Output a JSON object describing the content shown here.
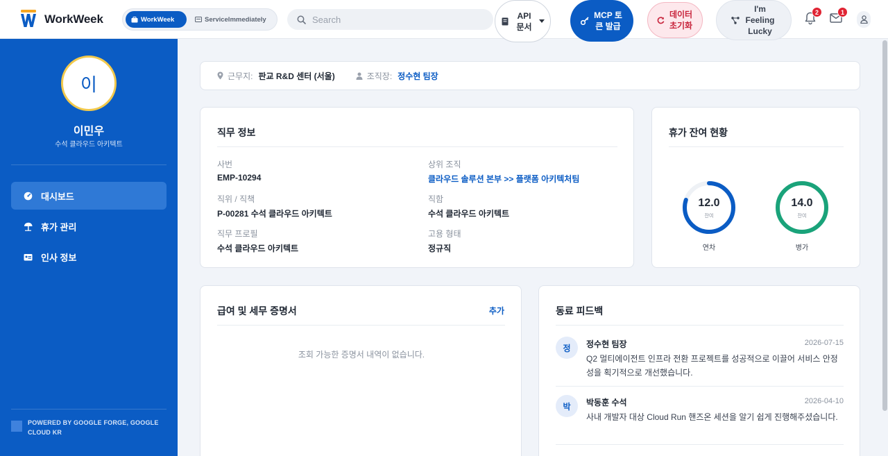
{
  "app": {
    "name": "WorkWeek"
  },
  "workspace_toggle": {
    "options": [
      {
        "label": "WorkWeek",
        "icon": "briefcase-icon",
        "active": true
      },
      {
        "label": "ServiceImmediately",
        "icon": "id-card-icon",
        "active": false
      }
    ]
  },
  "search": {
    "placeholder": "Search"
  },
  "header_buttons": {
    "api_docs": "API 문서",
    "mcp_token": "MCP 토큰 발급",
    "reset_data": "데이터 초기화",
    "lucky": "I'm Feeling Lucky"
  },
  "notifications": {
    "bell_count": "2",
    "mail_count": "1"
  },
  "colors": {
    "primary": "#0b5cc4",
    "annual_ring": "#0b5cc4",
    "sick_ring": "#1aa37a",
    "badge": "#e02433",
    "reset": "#c8243c"
  },
  "profile": {
    "initial": "이",
    "name": "이민우",
    "title": "수석 클라우드 아키텍트"
  },
  "nav": [
    {
      "label": "대시보드",
      "icon": "dashboard-icon",
      "active": true
    },
    {
      "label": "휴가 관리",
      "icon": "beach-umbrella-icon",
      "active": false
    },
    {
      "label": "인사 정보",
      "icon": "id-card-icon",
      "active": false
    }
  ],
  "footer": {
    "powered_by": "POWERED BY GOOGLE FORGE, GOOGLE CLOUD KR"
  },
  "location_bar": {
    "workplace_label": "근무지:",
    "workplace": "판교 R&D 센터 (서울)",
    "manager_label": "조직장:",
    "manager": "정수현 팀장"
  },
  "job_info": {
    "title": "직무 정보",
    "fields": {
      "employee_id": {
        "label": "사번",
        "value": "EMP-10294"
      },
      "parent_org": {
        "label": "상위 조직",
        "value": "클라우드 솔루션 본부 >> 플랫폼 아키텍처팀"
      },
      "position": {
        "label": "직위 / 직책",
        "value": "P-00281 수석 클라우드 아키텍트"
      },
      "job_title": {
        "label": "직함",
        "value": "수석 클라우드 아키텍트"
      },
      "job_profile": {
        "label": "직무 프로필",
        "value": "수석 클라우드 아키텍트"
      },
      "employment_type": {
        "label": "고용 형태",
        "value": "정규직"
      }
    }
  },
  "leave_balance": {
    "title": "휴가 잔여 현황",
    "items": [
      {
        "value": "12.0",
        "sub": "잔여",
        "label": "연차",
        "fill": 0.8,
        "color": "#0b5cc4"
      },
      {
        "value": "14.0",
        "sub": "잔여",
        "label": "병가",
        "fill": 1.0,
        "color": "#1aa37a"
      }
    ]
  },
  "payroll": {
    "title": "급여 및 세무 증명서",
    "add_label": "추가",
    "empty_text": "조회 가능한 증명서 내역이 없습니다."
  },
  "feedback": {
    "title": "동료 피드백",
    "items": [
      {
        "initial": "정",
        "name": "정수현 팀장",
        "date": "2026-07-15",
        "text": "Q2 멀티에이전트 인프라 전환 프로젝트를 성공적으로 이끌어 서비스 안정성을 획기적으로 개선했습니다."
      },
      {
        "initial": "박",
        "name": "박동훈 수석",
        "date": "2026-04-10",
        "text": "사내 개발자 대상 Cloud Run 핸즈온 세션을 알기 쉽게 진행해주셨습니다."
      }
    ]
  }
}
